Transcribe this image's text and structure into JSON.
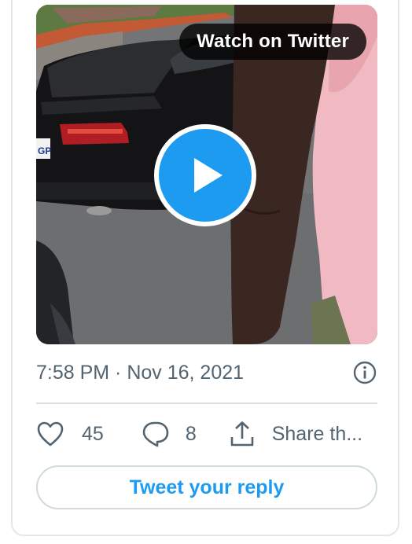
{
  "media": {
    "watch_label": "Watch on Twitter",
    "plate_text": "GP"
  },
  "meta": {
    "timestamp": "7:58 PM · Nov 16, 2021"
  },
  "actions": {
    "likes_count": "45",
    "replies_count": "8",
    "share_label": "Share th..."
  },
  "reply_box": {
    "label": "Tweet your reply"
  },
  "colors": {
    "accent": "#1d9bf0",
    "text_secondary": "#536471",
    "border": "#cfd9de"
  }
}
